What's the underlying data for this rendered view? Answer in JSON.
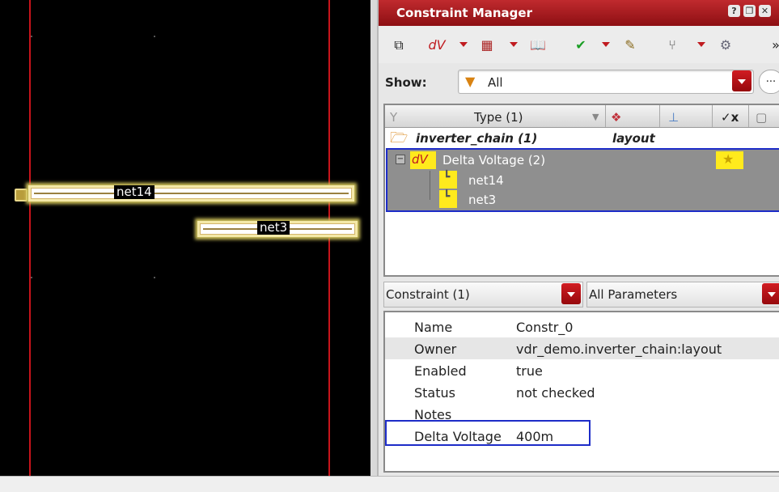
{
  "layout_canvas": {
    "nets": [
      {
        "label": "net14"
      },
      {
        "label": "net3"
      }
    ]
  },
  "window": {
    "title": "Constraint Manager",
    "buttons": [
      "?",
      "❐",
      "✕"
    ]
  },
  "toolbar": {
    "overflow": "»"
  },
  "filter": {
    "show_label": "Show:",
    "show_value": "All",
    "more_button": "..."
  },
  "tree": {
    "headers": {
      "type": "Type (1)"
    },
    "rows": [
      {
        "name": "inverter_chain (1)",
        "view": "layout"
      },
      {
        "name": "Delta Voltage (2)"
      },
      {
        "name": "net14"
      },
      {
        "name": "net3"
      }
    ]
  },
  "param_panel": {
    "constraint_select": "Constraint (1)",
    "parameter_select": "All Parameters",
    "properties": [
      {
        "key": "Name",
        "value": "Constr_0"
      },
      {
        "key": "Owner",
        "value": "vdr_demo.inverter_chain:layout"
      },
      {
        "key": "Enabled",
        "value": "true"
      },
      {
        "key": "Status",
        "value": "not checked"
      },
      {
        "key": "Notes",
        "value": ""
      },
      {
        "key": "Delta Voltage",
        "value": "400m"
      }
    ]
  },
  "colors": {
    "title_bar": "#b3171c",
    "selection": "#8f8f8f",
    "highlight_border": "#1d2cc8",
    "net_highlight": "#ffea1d",
    "canvas_bg": "#000000",
    "guide_line": "#c8141b"
  }
}
